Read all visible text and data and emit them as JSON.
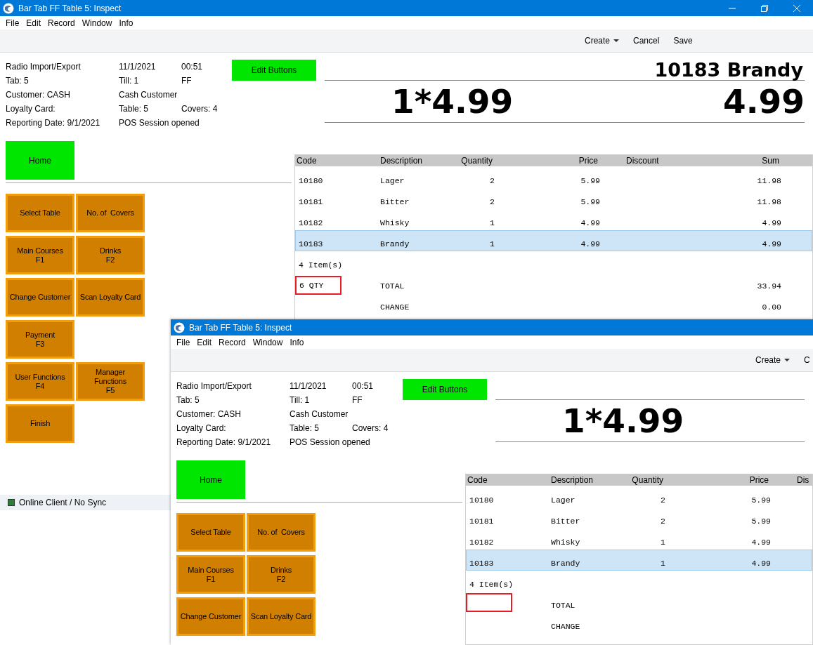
{
  "windows": [
    {
      "title": "Bar Tab FF Table 5: Inspect",
      "caption_buttons": true,
      "menu": [
        "File",
        "Edit",
        "Record",
        "Window",
        "Info"
      ],
      "toolbar": [
        {
          "label": "Create",
          "kind": "dropdown"
        },
        {
          "label": "Cancel",
          "kind": "plain"
        },
        {
          "label": "Save",
          "kind": "plain"
        }
      ],
      "info": [
        [
          "Radio Import/Export",
          "11/1/2021",
          "00:51"
        ],
        [
          "Tab: 5",
          "Till: 1",
          "FF"
        ],
        [
          "Customer: CASH",
          "Cash Customer"
        ],
        [
          "Loyalty Card:",
          "Table: 5",
          "Covers: 4"
        ],
        [
          "Reporting Date: 9/1/2021",
          "POS Session opened"
        ]
      ],
      "edit_button": "Edit Buttons",
      "display": {
        "description": "10183 Brandy",
        "quantity_price": "1*4.99",
        "amount": "4.99"
      },
      "home_button": "Home",
      "function_buttons": [
        [
          "Select Table",
          "No. of  Covers"
        ],
        [
          "Main Courses\nF1",
          "Drinks\nF2"
        ],
        [
          "Change Customer",
          "Scan Loyalty Card"
        ],
        [
          "Payment\nF3"
        ],
        [
          "User Functions\nF4",
          "Manager\nFunctions\nF5"
        ],
        [
          "Finish"
        ]
      ],
      "table": {
        "columns": [
          {
            "kind": "code",
            "label": "Code"
          },
          {
            "kind": "description",
            "label": "Description"
          },
          {
            "kind": "quantity",
            "label": "Quantity"
          },
          {
            "kind": "price",
            "label": "Price"
          },
          {
            "kind": "discount",
            "label": "Discount"
          },
          {
            "kind": "sum",
            "label": "Sum"
          }
        ],
        "rows": [
          {
            "code": "10180",
            "description": "Lager",
            "quantity": "2",
            "price": "5.99",
            "sum": "11.98",
            "selected": false
          },
          {
            "code": "10181",
            "description": "Bitter",
            "quantity": "2",
            "price": "5.99",
            "sum": "11.98",
            "selected": false
          },
          {
            "code": "10182",
            "description": "Whisky",
            "quantity": "1",
            "price": "4.99",
            "sum": "4.99",
            "selected": false
          },
          {
            "code": "10183",
            "description": "Brandy",
            "quantity": "1",
            "price": "4.99",
            "sum": "4.99",
            "selected": true
          }
        ],
        "summary": [
          {
            "kind": "items",
            "label": "4 Item(s)"
          },
          {
            "kind": "total",
            "qty": "6 QTY",
            "qty_flagged": true,
            "label": "TOTAL",
            "sum": "33.94"
          },
          {
            "kind": "change",
            "label": "CHANGE",
            "sum": "0.00"
          }
        ]
      },
      "status": {
        "text": "Online Client / No Sync",
        "color": "#2e7d3a"
      }
    },
    {
      "title": "Bar Tab FF Table 5: Inspect",
      "caption_buttons": false,
      "menu": [
        "File",
        "Edit",
        "Record",
        "Window",
        "Info"
      ],
      "toolbar": [
        {
          "label": "Create",
          "kind": "dropdown"
        },
        {
          "label": "C",
          "kind": "plain"
        }
      ],
      "info": [
        [
          "Radio Import/Export",
          "11/1/2021",
          "00:51"
        ],
        [
          "Tab: 5",
          "Till: 1",
          "FF"
        ],
        [
          "Customer: CASH",
          "Cash Customer"
        ],
        [
          "Loyalty Card:",
          "Table: 5",
          "Covers: 4"
        ],
        [
          "Reporting Date: 9/1/2021",
          "POS Session opened"
        ]
      ],
      "edit_button": "Edit Buttons",
      "display": {
        "quantity_price": "1*4.99"
      },
      "home_button": "Home",
      "function_buttons": [
        [
          "Select Table",
          "No. of  Covers"
        ],
        [
          "Main Courses\nF1",
          "Drinks\nF2"
        ],
        [
          "Change Customer",
          "Scan Loyalty Card"
        ]
      ],
      "table": {
        "columns": [
          {
            "kind": "code",
            "label": "Code"
          },
          {
            "kind": "description",
            "label": "Description"
          },
          {
            "kind": "quantity",
            "label": "Quantity"
          },
          {
            "kind": "price",
            "label": "Price"
          },
          {
            "kind": "discount",
            "label": "Dis"
          }
        ],
        "rows": [
          {
            "code": "10180",
            "description": "Lager",
            "quantity": "2",
            "price": "5.99",
            "selected": false
          },
          {
            "code": "10181",
            "description": "Bitter",
            "quantity": "2",
            "price": "5.99",
            "selected": false
          },
          {
            "code": "10182",
            "description": "Whisky",
            "quantity": "1",
            "price": "4.99",
            "selected": false
          },
          {
            "code": "10183",
            "description": "Brandy",
            "quantity": "1",
            "price": "4.99",
            "selected": true
          }
        ],
        "summary": [
          {
            "kind": "items",
            "label": "4 Item(s)"
          },
          {
            "kind": "total",
            "qty_flagged": true,
            "label": "TOTAL"
          },
          {
            "kind": "change",
            "label": "CHANGE"
          }
        ]
      }
    }
  ]
}
